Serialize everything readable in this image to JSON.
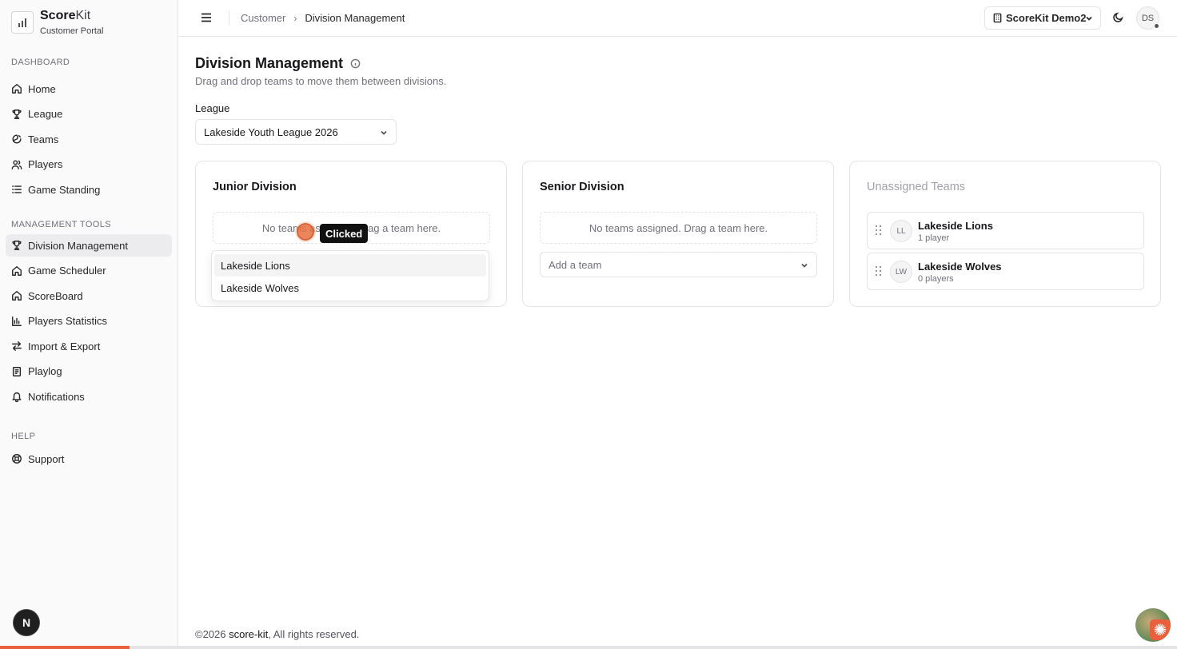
{
  "app": {
    "name_bold": "Score",
    "name_light": "Kit",
    "subtitle": "Customer Portal"
  },
  "sidebar": {
    "sections": [
      {
        "heading": "DASHBOARD",
        "items": [
          {
            "label": "Home",
            "icon": "home-icon"
          },
          {
            "label": "League",
            "icon": "trophy-icon"
          },
          {
            "label": "Teams",
            "icon": "teams-icon"
          },
          {
            "label": "Players",
            "icon": "users-icon"
          },
          {
            "label": "Game Standing",
            "icon": "list-icon"
          }
        ]
      },
      {
        "heading": "MANAGEMENT TOOLS",
        "items": [
          {
            "label": "Division Management",
            "icon": "trophy-icon",
            "active": true
          },
          {
            "label": "Game Scheduler",
            "icon": "home-icon"
          },
          {
            "label": "ScoreBoard",
            "icon": "home-icon"
          },
          {
            "label": "Players Statistics",
            "icon": "bar-chart-icon"
          },
          {
            "label": "Import & Export",
            "icon": "arrows-icon"
          },
          {
            "label": "Playlog",
            "icon": "log-icon"
          },
          {
            "label": "Notifications",
            "icon": "bell-icon"
          }
        ]
      },
      {
        "heading": "HELP",
        "items": [
          {
            "label": "Support",
            "icon": "lifebuoy-icon"
          }
        ]
      }
    ],
    "badge": "N"
  },
  "header": {
    "breadcrumb": {
      "parent": "Customer",
      "separator": "›",
      "current": "Division Management"
    },
    "org": "ScoreKit Demo2",
    "avatar": "DS"
  },
  "main": {
    "title": "Division Management",
    "subtitle": "Drag and drop teams to move them between divisions.",
    "league_label": "League",
    "league_value": "Lakeside Youth League 2026",
    "divisions": [
      {
        "title": "Junior Division",
        "empty_text": "No teams assigned. Drag a team here.",
        "dropdown_options": [
          "Lakeside Lions",
          "Lakeside Wolves"
        ]
      },
      {
        "title": "Senior Division",
        "empty_text": "No teams assigned. Drag a team here.",
        "add_placeholder": "Add a team"
      }
    ],
    "unassigned": {
      "title": "Unassigned Teams",
      "teams": [
        {
          "initials": "LL",
          "name": "Lakeside Lions",
          "count": "1 player"
        },
        {
          "initials": "LW",
          "name": "Lakeside Wolves",
          "count": "0 players"
        }
      ]
    }
  },
  "overlay": {
    "click_label": "Clicked"
  },
  "footer": {
    "year": "©2026",
    "brand": "score-kit",
    "rights": ", All rights reserved."
  },
  "progress": {
    "fraction": 0.11
  },
  "colors": {
    "accent": "#e8603c",
    "border": "#e4e4e7",
    "muted": "#71717a"
  }
}
